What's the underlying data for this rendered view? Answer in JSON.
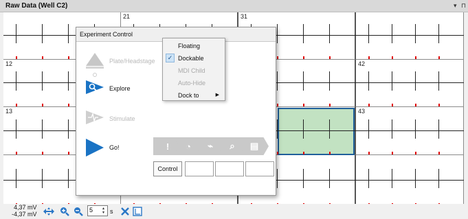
{
  "window": {
    "title": "Raw Data (Well C2)",
    "controls": [
      "▾",
      "⊓"
    ]
  },
  "grid": {
    "cell_labels": [
      "21",
      "31",
      "12",
      "42",
      "13",
      "43"
    ]
  },
  "bottom": {
    "mv_max": "4,37 mV",
    "mv_min": "-4,37 mV",
    "time_value": "5",
    "time_unit": "s",
    "icons": [
      "move-arrows-icon",
      "zoom-in-icon",
      "zoom-out-icon",
      "close-x-icon",
      "layout-icon"
    ]
  },
  "panel": {
    "title": "Experiment Control",
    "steps": [
      {
        "label": "Plate/Headstage",
        "state": "disabled"
      },
      {
        "label": "Explore",
        "state": "active"
      },
      {
        "label": "Stimulate",
        "state": "disabled"
      },
      {
        "label": "Go!",
        "state": "active"
      }
    ],
    "control_button": "Control"
  },
  "context_menu": {
    "items": [
      {
        "label": "Floating",
        "checked": false,
        "disabled": false
      },
      {
        "label": "Dockable",
        "checked": true,
        "disabled": false
      },
      {
        "label": "MDI Child",
        "checked": false,
        "disabled": true
      },
      {
        "label": "Auto-Hide",
        "checked": false,
        "disabled": true
      },
      {
        "label": "Dock to",
        "checked": false,
        "disabled": false,
        "submenu": true
      }
    ]
  },
  "colors": {
    "accent_blue": "#1a73c4",
    "selected_fill": "#9fd59f",
    "selected_border": "#1f5f9a",
    "trace": "#222222",
    "marker": "#e00000"
  }
}
